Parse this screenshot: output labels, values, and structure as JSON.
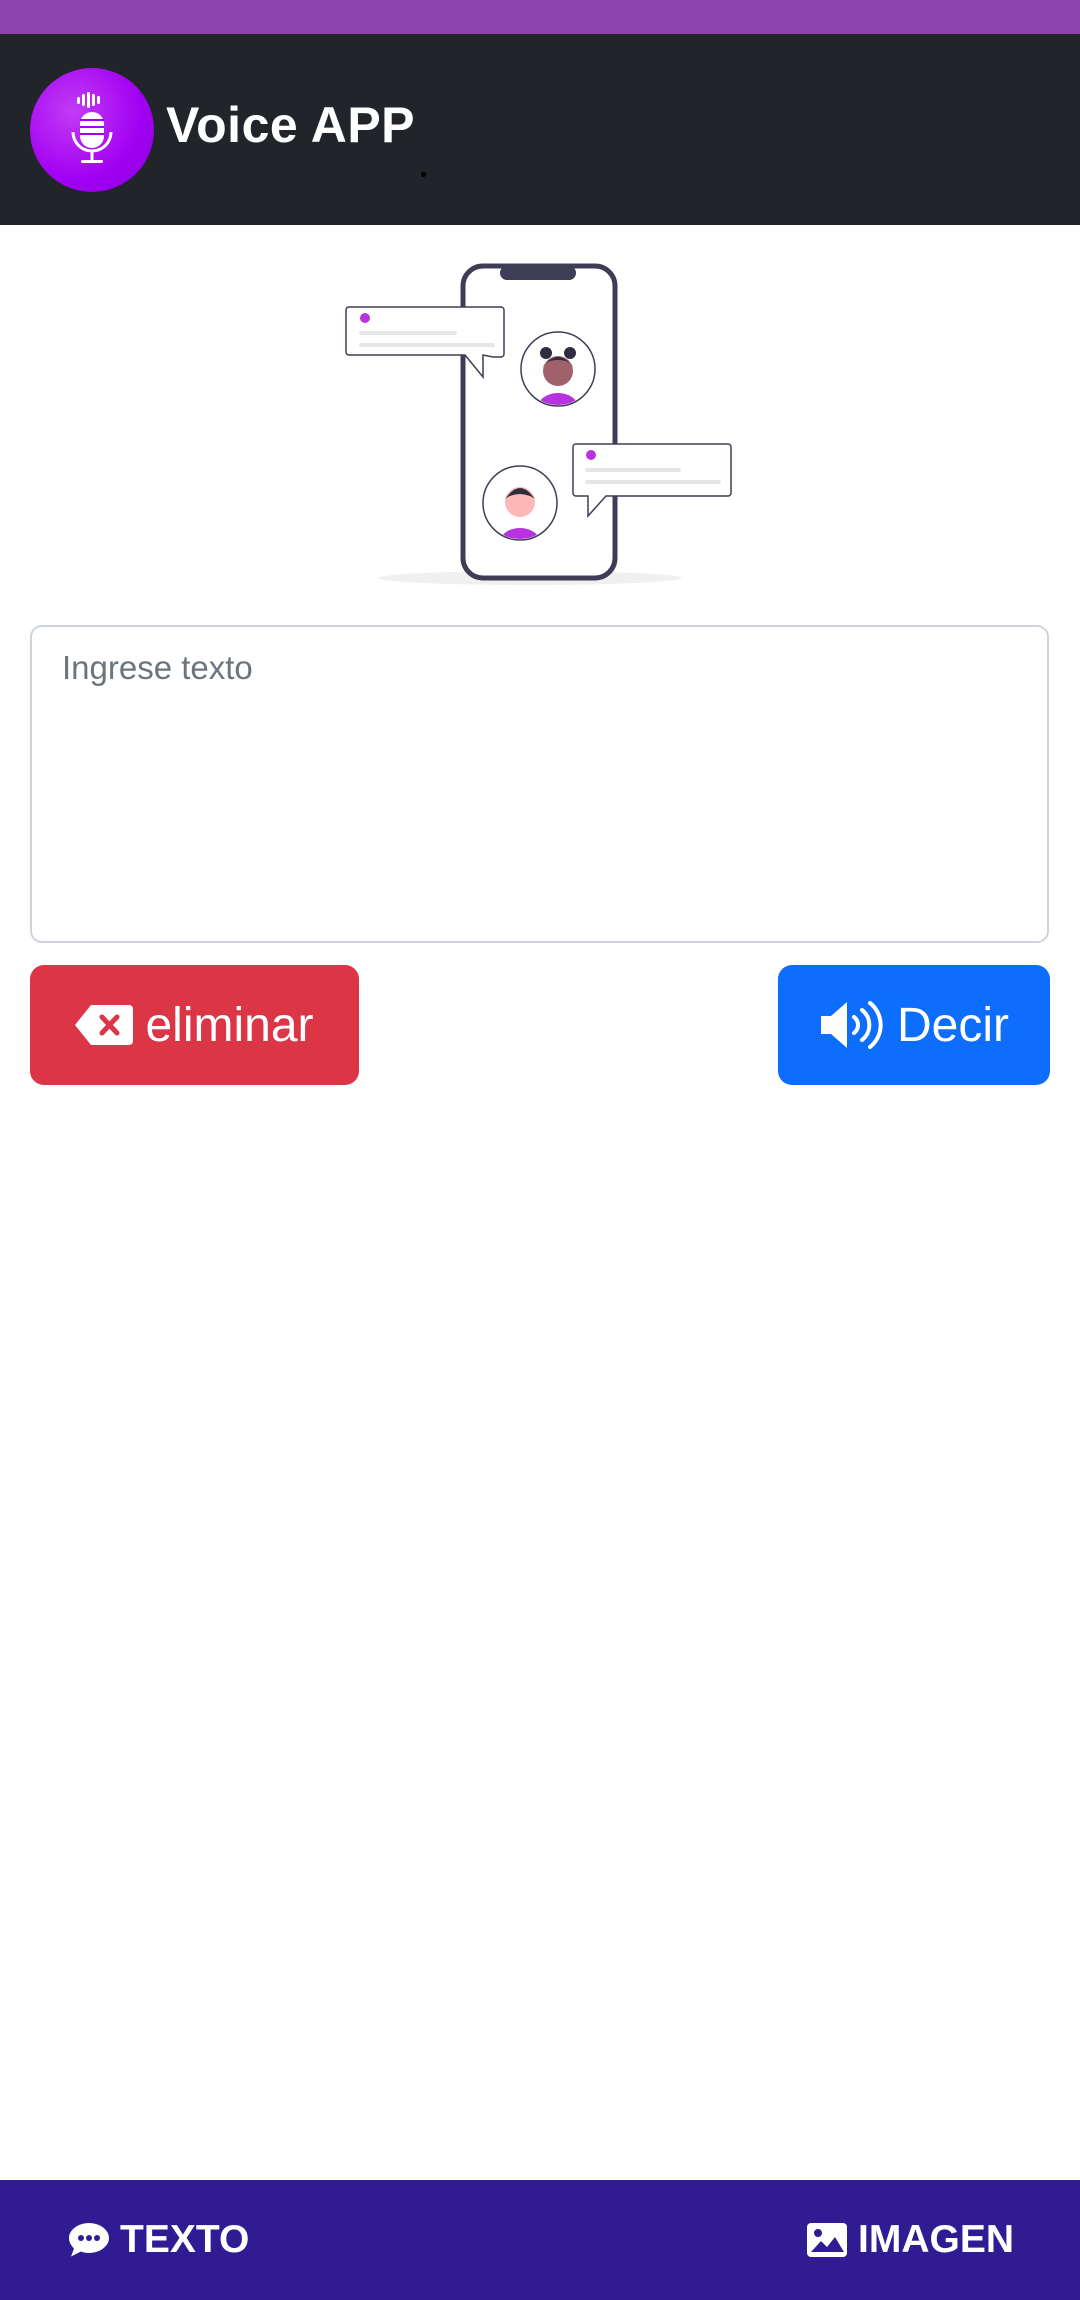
{
  "header": {
    "title": "Voice APP",
    "logo_icon": "microphone-icon",
    "accent_color": "#a100f2",
    "background_color": "#212529"
  },
  "status_bar": {
    "color": "#8e44ad"
  },
  "main": {
    "illustration": "chat-phone-illustration",
    "input": {
      "placeholder": "Ingrese texto",
      "value": ""
    },
    "delete_button": {
      "label": "eliminar",
      "icon": "backspace-icon",
      "color": "#dc3545"
    },
    "say_button": {
      "label": "Decir",
      "icon": "volume-icon",
      "color": "#0d6efd"
    }
  },
  "bottom_nav": {
    "background_color": "#311b92",
    "items": [
      {
        "label": "TEXTO",
        "icon": "comment-icon"
      },
      {
        "label": "IMAGEN",
        "icon": "image-icon"
      }
    ]
  }
}
